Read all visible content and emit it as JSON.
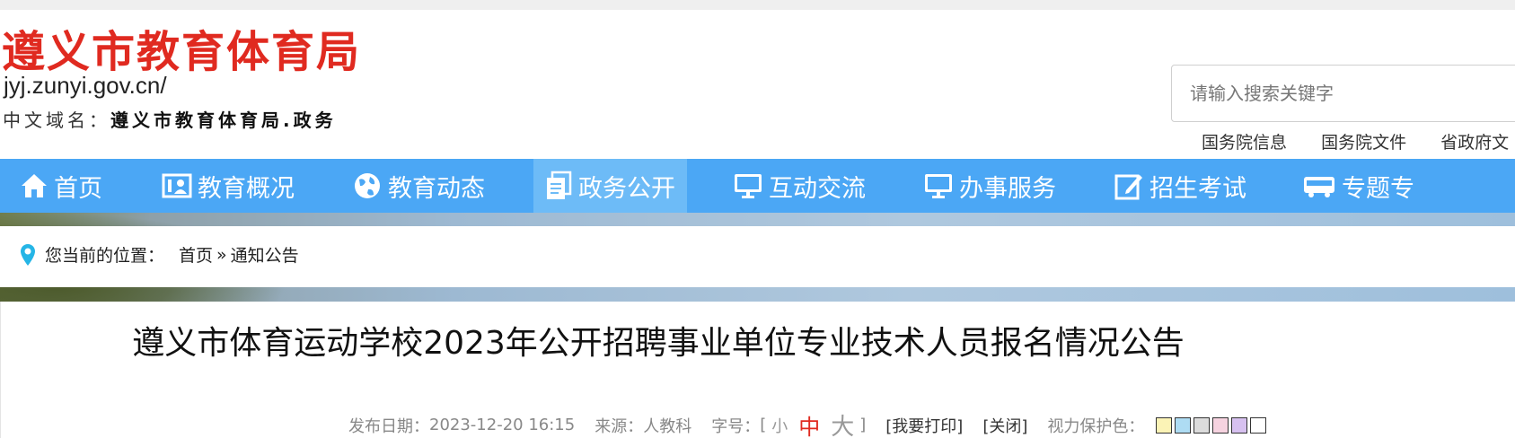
{
  "header": {
    "site_title": "遵义市教育体育局",
    "domain_url": "jyj.zunyi.gov.cn/",
    "cn_domain_label": "中文域名：",
    "cn_domain_value": "遵义市教育体育局.政务"
  },
  "search": {
    "placeholder": "请输入搜索关键字"
  },
  "top_links": [
    "国务院信息",
    "国务院文件",
    "省政府文"
  ],
  "nav": {
    "items": [
      {
        "label": "首页",
        "icon": "home-icon"
      },
      {
        "label": "教育概况",
        "icon": "id-card-icon"
      },
      {
        "label": "教育动态",
        "icon": "globe-icon"
      },
      {
        "label": "政务公开",
        "icon": "documents-icon",
        "active": true
      },
      {
        "label": "互动交流",
        "icon": "monitor-icon"
      },
      {
        "label": "办事服务",
        "icon": "monitor-icon"
      },
      {
        "label": "招生考试",
        "icon": "edit-icon"
      },
      {
        "label": "专题专",
        "icon": "bus-icon"
      }
    ]
  },
  "breadcrumb": {
    "label": "您当前的位置：",
    "home": "首页",
    "separator": "»",
    "current": "通知公告"
  },
  "article": {
    "title": "遵义市体育运动学校2023年公开招聘事业单位专业技术人员报名情况公告",
    "publish_label": "发布日期：",
    "publish_date": "2023-12-20 16:15",
    "source_label": "来源：",
    "source": "人教科",
    "font_label": "字号：",
    "bracket_open": "[",
    "size_small": "小",
    "size_medium": "中",
    "size_large": "大",
    "bracket_close": "]",
    "print": "[我要打印]",
    "close": "[关闭]",
    "eye_care_label": "视力保护色："
  },
  "colors": {
    "brand_red": "#e02a20",
    "nav_blue": "#4ba7f5",
    "swatches": [
      "#fbf3b6",
      "#aedcf3",
      "#dcdcdc",
      "#f6d3e0",
      "#d7c1f0",
      "#ffffff"
    ]
  }
}
